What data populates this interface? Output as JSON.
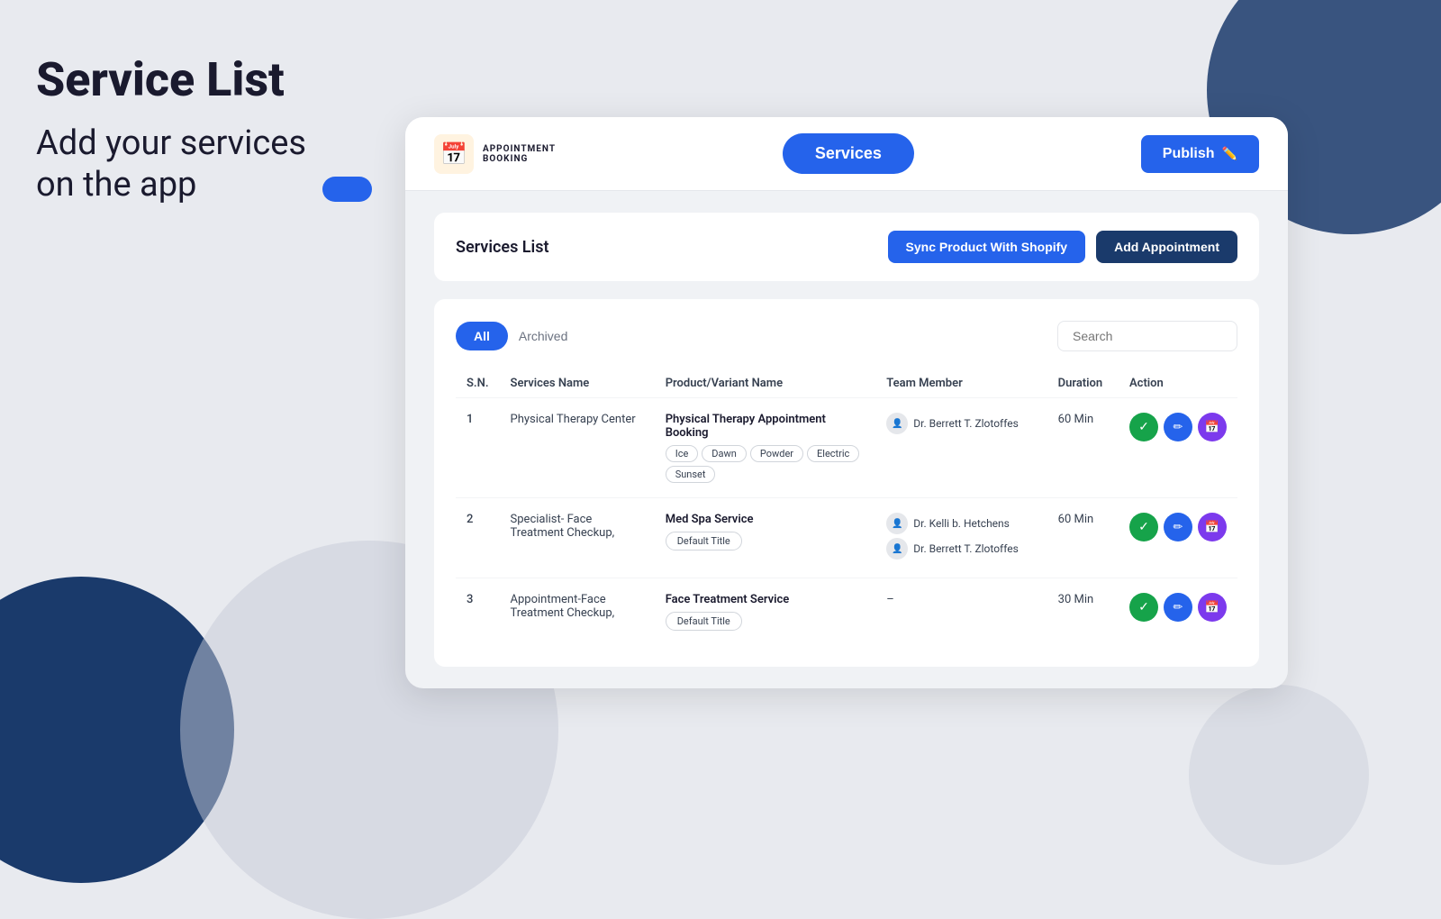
{
  "page": {
    "title": "Service List",
    "subtitle_line1": "Add your services",
    "subtitle_line2": "on the app"
  },
  "nav": {
    "logo_text_top": "APPOINTMENT",
    "logo_text_bottom": "BOOKING",
    "logo_emoji": "📅",
    "services_button": "Services",
    "publish_button": "Publish"
  },
  "services_header": {
    "title": "Services List",
    "sync_button": "Sync Product With Shopify",
    "add_button": "Add Appointment"
  },
  "table": {
    "filters": {
      "all": "All",
      "archived": "Archived"
    },
    "search_placeholder": "Search",
    "columns": {
      "sn": "S.N.",
      "services_name": "Services Name",
      "product_variant": "Product/Variant Name",
      "team_member": "Team Member",
      "duration": "Duration",
      "action": "Action"
    },
    "rows": [
      {
        "sn": "1",
        "service_name": "Physical Therapy Center",
        "product_name": "Physical Therapy Appointment Booking",
        "variants": [
          "Ice",
          "Dawn",
          "Powder",
          "Electric",
          "Sunset"
        ],
        "team_members": [
          "Dr. Berrett T. Zlotoffes"
        ],
        "duration": "60 Min",
        "has_dash": false
      },
      {
        "sn": "2",
        "service_name": "Specialist- Face Treatment Checkup,",
        "product_name": "Med Spa Service",
        "variants": [
          "Default Title"
        ],
        "team_members": [
          "Dr. Kelli b. Hetchens",
          "Dr. Berrett T. Zlotoffes"
        ],
        "duration": "60 Min",
        "has_dash": false
      },
      {
        "sn": "3",
        "service_name": "Appointment-Face Treatment Checkup,",
        "product_name": "Face Treatment Service",
        "variants": [
          "Default Title"
        ],
        "team_members": [],
        "duration": "30 Min",
        "has_dash": true
      }
    ]
  }
}
